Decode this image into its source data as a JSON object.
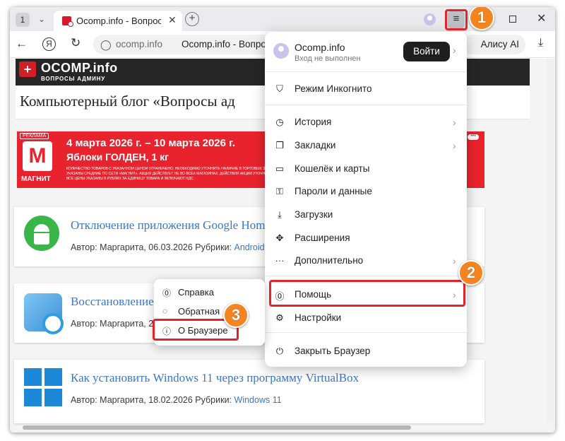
{
  "tabbar": {
    "tab_count": "1",
    "active_tab_title": "Ocomp.info - Вопросы",
    "new_tab_symbol": "+",
    "menu_symbol": "≡"
  },
  "toolbar": {
    "url_host": "ocomp.info",
    "url_title": "Ocomp.info - Вопросы адм",
    "alice_label": "Алису AI",
    "yandex_letter": "Я"
  },
  "site": {
    "logo_text": "OCOMP.info",
    "logo_tagline": "ВОПРОСЫ АДМИНУ",
    "blog_title": "Компьютерный блог «Вопросы ад"
  },
  "ad": {
    "label": "РЕКЛАМА",
    "logo_letter": "М",
    "brand": "МАГНИТ",
    "line1": "4 марта 2026 г. – 10 марта 2026 г.",
    "line2": "Яблоки ГОЛДЕН, 1 кг",
    "fine_print": "КОЛИЧЕСТВО ТОВАРОВ С УКАЗАННОЙ ЦЕНОЙ ОГРАНИЧЕНО, НЕОБХОДИМО УТОЧНИТЬ НАЛИЧИЕ В ТОРГОВЫХ ЗАЛАХ. ЦЕНЫ И СКИДКИ УКАЗАНЫ СРЕДНИЕ ПО СЕТИ «МАГНИТ». АКЦИЯ ДЕЙСТВУЕТ НЕ ВО ВСЕХ МАГАЗИНАХ. ДЕЙСТВИЯ АКЦИИ УТОЧНЯЙТЕ В МАГАЗИНАХ. ВСЕ ЦЕНЫ УКАЗАНЫ В РУБЛЯХ ЗА ЕДИНИЦУ ТОВАРА И ВКЛЮЧАЮТ НДС."
  },
  "articles": [
    {
      "title": "Отключение приложения Google Home",
      "meta": "Автор: Маргарита, 06.03.2026 Рубрики: ",
      "category": "Android"
    },
    {
      "title": "Восстановление",
      "meta": "Автор: Маргарита, 2",
      "category": ""
    },
    {
      "title": "Как установить Windows 11 через программу VirtualBox",
      "meta": "Автор: Маргарита, 18.02.2026 Рубрики: ",
      "category": "Windows 11"
    }
  ],
  "browser_menu": {
    "account_name": "Ocomp.info",
    "account_status": "Вход не выполнен",
    "login_label": "Войти",
    "items": [
      {
        "label": "Режим Инкогнито",
        "icon": "incognito-icon"
      },
      {
        "label": "История",
        "icon": "history-icon"
      },
      {
        "label": "Закладки",
        "icon": "bookmarks-icon"
      },
      {
        "label": "Кошелёк и карты",
        "icon": "wallet-icon"
      },
      {
        "label": "Пароли и данные",
        "icon": "passwords-icon"
      },
      {
        "label": "Загрузки",
        "icon": "downloads-icon"
      },
      {
        "label": "Расширения",
        "icon": "extensions-icon"
      },
      {
        "label": "Дополнительно",
        "icon": "more-icon"
      },
      {
        "label": "Помощь",
        "icon": "help-icon"
      },
      {
        "label": "Настройки",
        "icon": "settings-icon"
      },
      {
        "label": "Закрыть Браузер",
        "icon": "power-icon"
      }
    ]
  },
  "help_submenu": {
    "items": [
      {
        "label": "Справка",
        "icon": "help-icon"
      },
      {
        "label": "Обратная",
        "icon": "feedback-icon"
      },
      {
        "label": "О Браузере",
        "icon": "info-icon"
      }
    ]
  },
  "annotations": {
    "step1": "1",
    "step2": "2",
    "step3": "3",
    "highlight_color": "#e4232b",
    "badge_color": "#f4841f"
  }
}
